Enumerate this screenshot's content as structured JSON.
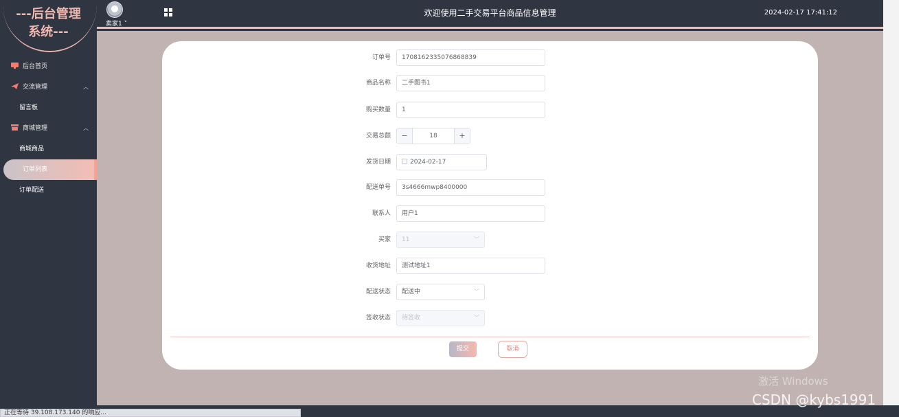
{
  "sidebar": {
    "logo_line1": "---后台管理",
    "logo_line2": "系统---",
    "items": [
      {
        "label": "后台首页",
        "icon": "monitor-icon"
      },
      {
        "label": "交流管理",
        "icon": "paper-plane-icon",
        "children": [
          "留言板"
        ]
      },
      {
        "label": "商城管理",
        "icon": "shop-icon",
        "children": [
          "商城商品",
          "订单列表",
          "订单配送"
        ]
      }
    ],
    "active": "订单列表"
  },
  "header": {
    "user": "卖家1",
    "title": "欢迎使用二手交易平台商品信息管理",
    "time": "2024-02-17 17:41:12"
  },
  "form": {
    "fields": [
      {
        "label": "订单号",
        "value": "1708162335076868839"
      },
      {
        "label": "商品名称",
        "value": "二手图书1"
      },
      {
        "label": "购买数量",
        "value": "1"
      },
      {
        "label": "交易总额",
        "value": "18"
      },
      {
        "label": "发货日期",
        "value": "2024-02-17"
      },
      {
        "label": "配送单号",
        "value": "3s4666mwp8400000"
      },
      {
        "label": "联系人",
        "value": "用户1"
      },
      {
        "label": "买家",
        "value": "11"
      },
      {
        "label": "收货地址",
        "value": "测试地址1"
      },
      {
        "label": "配送状态",
        "value": "配送中"
      },
      {
        "label": "签收状态",
        "value": "待签收"
      }
    ],
    "submit_label": "提交",
    "cancel_label": "取消"
  },
  "watermark": {
    "activate": "激活 Windows",
    "csdn": "CSDN @kybs1991"
  },
  "statusbar": "正在等待 39.108.173.140 的响应..."
}
